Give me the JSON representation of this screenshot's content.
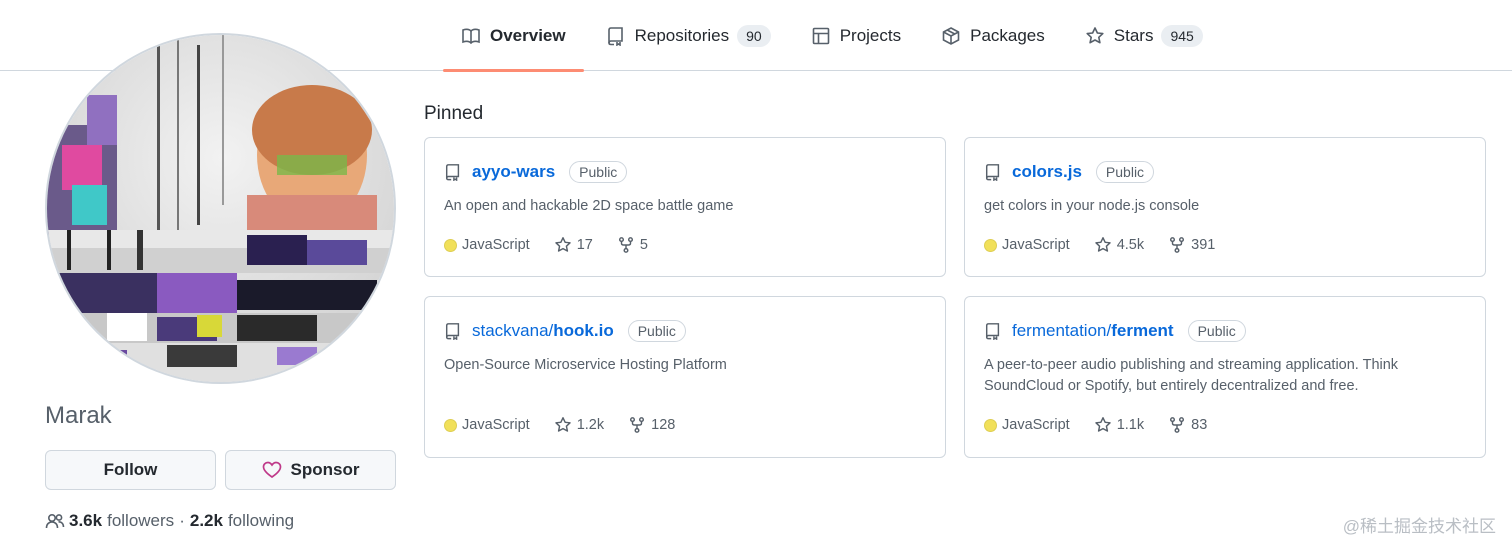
{
  "tabs": [
    {
      "label": "Overview",
      "icon": "book-icon",
      "active": true
    },
    {
      "label": "Repositories",
      "icon": "repo-icon",
      "count": "90"
    },
    {
      "label": "Projects",
      "icon": "table-icon"
    },
    {
      "label": "Packages",
      "icon": "package-icon"
    },
    {
      "label": "Stars",
      "icon": "star-icon",
      "count": "945"
    }
  ],
  "profile": {
    "name": "Marak",
    "follow_label": "Follow",
    "sponsor_label": "Sponsor",
    "followers_count": "3.6k",
    "followers_label": "followers",
    "separator": "·",
    "following_count": "2.2k",
    "following_label": "following"
  },
  "pinned": {
    "title": "Pinned",
    "repos": [
      {
        "owner": "",
        "name": "ayyo-wars",
        "visibility": "Public",
        "description": "An open and hackable 2D space battle game",
        "language": "JavaScript",
        "stars": "17",
        "forks": "5"
      },
      {
        "owner": "",
        "name": "colors.js",
        "visibility": "Public",
        "description": "get colors in your node.js console",
        "language": "JavaScript",
        "stars": "4.5k",
        "forks": "391"
      },
      {
        "owner": "stackvana/",
        "name": "hook.io",
        "visibility": "Public",
        "description": "Open-Source Microservice Hosting Platform",
        "language": "JavaScript",
        "stars": "1.2k",
        "forks": "128"
      },
      {
        "owner": "fermentation/",
        "name": "ferment",
        "visibility": "Public",
        "description": "A peer-to-peer audio publishing and streaming application. Think SoundCloud or Spotify, but entirely decentralized and free.",
        "language": "JavaScript",
        "stars": "1.1k",
        "forks": "83"
      }
    ]
  },
  "watermark": "@稀土掘金技术社区",
  "colors": {
    "link": "#0969da",
    "javascript": "#f1e05a",
    "tab_underline": "#fd8c73",
    "sponsor_heart": "#bf3989"
  }
}
